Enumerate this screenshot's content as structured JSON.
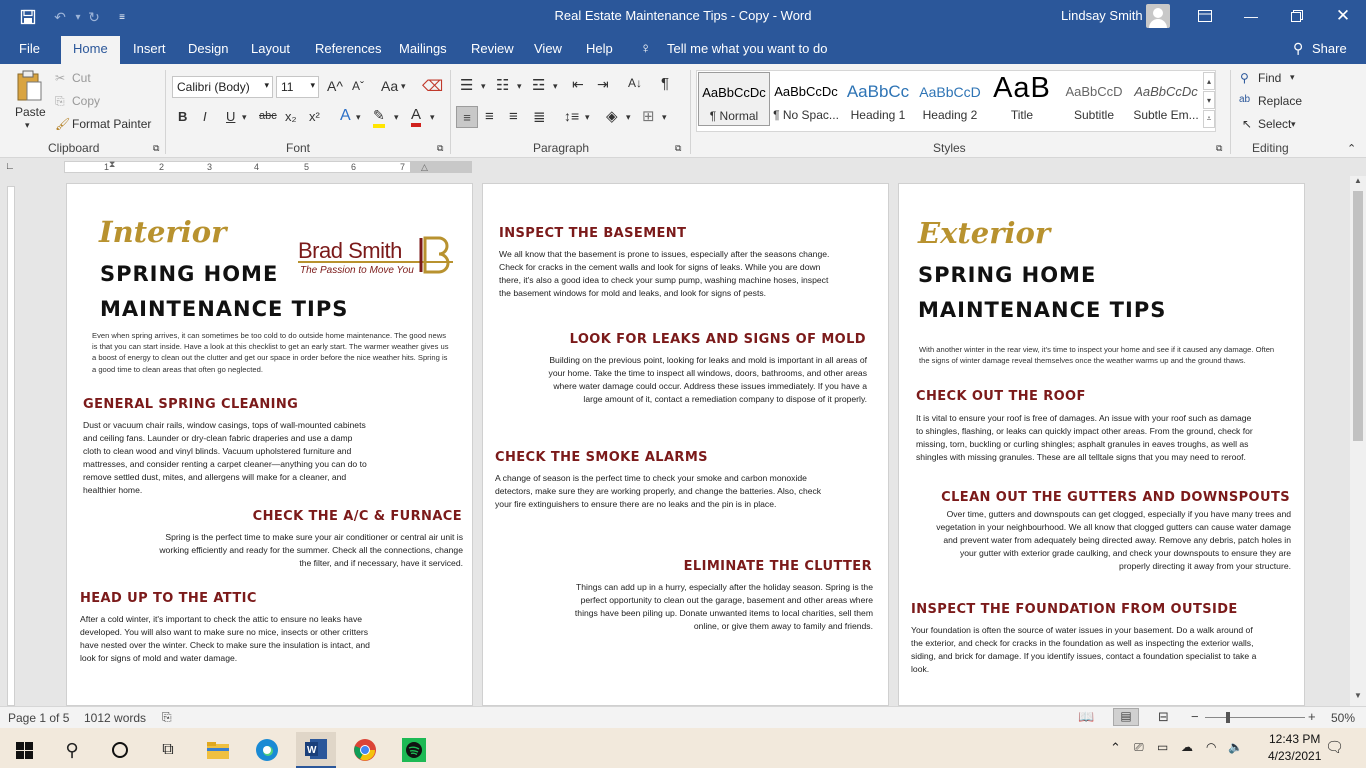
{
  "titlebar": {
    "title": "Real Estate Maintenance Tips - Copy  -  Word",
    "user": "Lindsay Smith"
  },
  "tabs": [
    "File",
    "Home",
    "Insert",
    "Design",
    "Layout",
    "References",
    "Mailings",
    "Review",
    "View",
    "Help"
  ],
  "tell_me": "Tell me what you want to do",
  "share": "Share",
  "ribbon": {
    "clipboard": {
      "paste": "Paste",
      "cut": "Cut",
      "copy": "Copy",
      "format_painter": "Format Painter",
      "label": "Clipboard"
    },
    "font": {
      "name": "Calibri (Body)",
      "size": "11",
      "label": "Font",
      "bold": "B",
      "italic": "I",
      "underline": "U",
      "strike": "abc",
      "sub": "x₂",
      "sup": "x²",
      "grow": "A^",
      "shrink": "Aˇ",
      "case": "Aa"
    },
    "paragraph": {
      "label": "Paragraph"
    },
    "styles": {
      "label": "Styles",
      "items": [
        {
          "preview": "AaBbCcDc",
          "name": "¶ Normal"
        },
        {
          "preview": "AaBbCcDc",
          "name": "¶ No Spac..."
        },
        {
          "preview": "AaBbCc",
          "name": "Heading 1"
        },
        {
          "preview": "AaBbCcD",
          "name": "Heading 2"
        },
        {
          "preview": "AaB",
          "name": "Title"
        },
        {
          "preview": "AaBbCcD",
          "name": "Subtitle"
        },
        {
          "preview": "AaBbCcDc",
          "name": "Subtle Em..."
        }
      ]
    },
    "editing": {
      "label": "Editing",
      "find": "Find",
      "replace": "Replace",
      "select": "Select"
    }
  },
  "pages": {
    "p1": {
      "script": "Interior",
      "big1": "SPRING HOME",
      "big2": "MAINTENANCE TIPS",
      "logo_name": "Brad Smith",
      "logo_tag": "The Passion to Move You",
      "intro": "Even when spring arrives, it can sometimes be too cold to do outside home maintenance. The good news is that you can start inside. Have a look at this checklist to get an early start. The warmer weather gives us a boost of energy to clean out the clutter and get our space in order before the nice weather hits. Spring is a good time to clean areas that often go neglected.",
      "s1_title": "GENERAL SPRING CLEANING",
      "s1_body": "Dust or vacuum chair rails, window casings, tops of wall-mounted cabinets and ceiling fans. Launder or dry-clean fabric draperies and use a damp cloth to clean wood and vinyl blinds. Vacuum upholstered furniture and mattresses, and consider renting a carpet cleaner—anything you can do to remove settled dust, mites, and allergens will make for a cleaner, and healthier home.",
      "s2_title": "CHECK THE A/C & FURNACE",
      "s2_body": "Spring is the perfect time to make sure your air conditioner or central air unit is working efficiently and ready for the summer. Check all the connections, change the filter, and if necessary, have it serviced.",
      "s3_title": "HEAD UP TO THE ATTIC",
      "s3_body": "After a cold winter, it's important to check the attic to ensure no leaks have developed. You will also want to make sure no mice, insects or other critters have nested over the winter. Check to make sure the insulation is intact, and look for signs of mold and water damage."
    },
    "p2": {
      "s1_title": "INSPECT THE BASEMENT",
      "s1_body": "We all know that the basement is prone to issues, especially after the seasons change. Check for cracks in the cement walls and look for signs of leaks. While you are down there, it's also a good idea to check your sump pump, washing machine hoses, inspect the basement windows for mold and leaks, and look for signs of pests.",
      "s2_title": "LOOK FOR LEAKS AND SIGNS OF MOLD",
      "s2_body": "Building on the previous point, looking for leaks and mold is important in all areas of your home. Take the time to inspect all windows, doors, bathrooms, and other areas where water damage could occur. Address these issues immediately. If you have a large amount of it, contact a remediation company to dispose of it properly.",
      "s3_title": "CHECK THE SMOKE ALARMS",
      "s3_body": "A change of season is the perfect time to check your smoke and carbon monoxide detectors, make sure they are working properly, and change the batteries. Also, check your fire extinguishers to ensure there are no leaks and the pin is in place.",
      "s4_title": "ELIMINATE THE CLUTTER",
      "s4_body": "Things can add up in a hurry, especially after the holiday season. Spring is the perfect opportunity to clean out the garage, basement and other areas where things have been piling up. Donate unwanted items to local charities, sell them online, or give them away to family and friends."
    },
    "p3": {
      "script": "Exterior",
      "big1": "SPRING HOME",
      "big2": "MAINTENANCE TIPS",
      "intro": "With another winter in the rear view, it's time to inspect your home and see if it caused any damage. Often the signs of winter damage reveal themselves once the weather warms up and the ground thaws.",
      "s1_title": "CHECK OUT THE ROOF",
      "s1_body": "It is vital to ensure your roof is free of damages. An issue with your roof such as damage to shingles, flashing, or leaks can quickly impact other areas. From the ground, check for missing, torn, buckling or curling shingles; asphalt granules in eaves troughs, as well as shingles with missing granules. These are all telltale signs that you may need to reroof.",
      "s2_title": "CLEAN OUT THE GUTTERS AND DOWNSPOUTS",
      "s2_body": "Over time, gutters and downspouts can get clogged, especially if you have many trees and vegetation in your neighbourhood. We all know that clogged gutters can cause water damage and prevent water from adequately being directed away. Remove any debris, patch holes in your gutter with exterior grade caulking, and check your downspouts to ensure they are properly directing it away from your structure.",
      "s3_title": "INSPECT THE FOUNDATION FROM OUTSIDE",
      "s3_body": "Your foundation is often the source of water issues in your basement. Do a walk around of the exterior, and check for cracks in the foundation as well as inspecting the exterior walls, siding, and brick for damage. If you identify issues, contact a foundation specialist to take a look."
    }
  },
  "status": {
    "page": "Page 1 of 5",
    "words": "1012 words",
    "zoom": "50%"
  },
  "taskbar": {
    "time": "12:43 PM",
    "date": "4/23/2021"
  },
  "colors": {
    "word_blue": "#2b579a",
    "heading_red": "#7b1a1a",
    "gold": "#b8922f"
  }
}
